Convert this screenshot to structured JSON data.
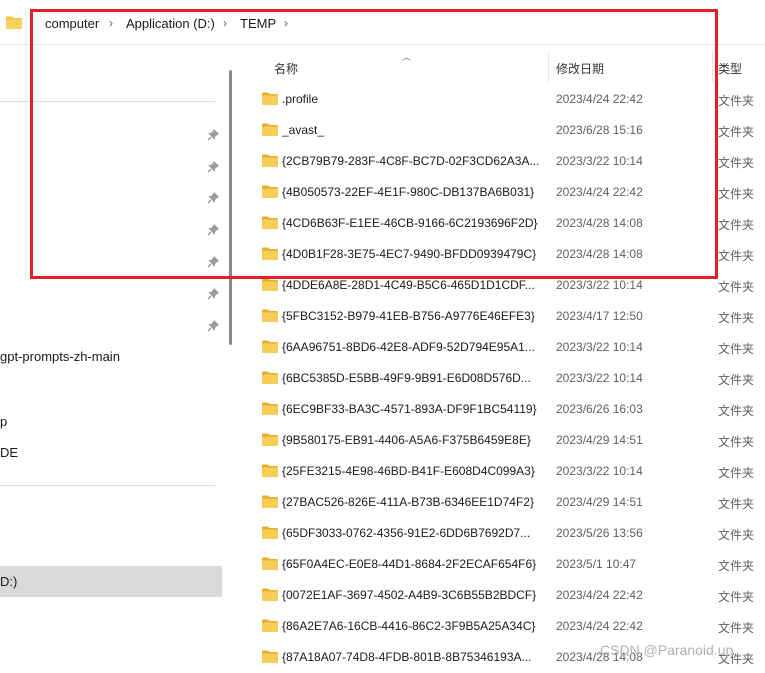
{
  "breadcrumb": [
    "computer",
    "Application (D:)",
    "TEMP"
  ],
  "nav": {
    "items": [
      "gpt-prompts-zh-main",
      "p",
      "DE",
      "D:)"
    ]
  },
  "columns": {
    "name": "名称",
    "date": "修改日期",
    "type": "类型"
  },
  "files": [
    {
      "name": ".profile",
      "date": "2023/4/24 22:42",
      "type": "文件夹"
    },
    {
      "name": "_avast_",
      "date": "2023/6/28 15:16",
      "type": "文件夹"
    },
    {
      "name": "{2CB79B79-283F-4C8F-BC7D-02F3CD62A3A...",
      "date": "2023/3/22 10:14",
      "type": "文件夹"
    },
    {
      "name": "{4B050573-22EF-4E1F-980C-DB137BA6B031}",
      "date": "2023/4/24 22:42",
      "type": "文件夹"
    },
    {
      "name": "{4CD6B63F-E1EE-46CB-9166-6C2193696F2D}",
      "date": "2023/4/28 14:08",
      "type": "文件夹"
    },
    {
      "name": "{4D0B1F28-3E75-4EC7-9490-BFDD0939479C}",
      "date": "2023/4/28 14:08",
      "type": "文件夹"
    },
    {
      "name": "{4DDE6A8E-28D1-4C49-B5C6-465D1D1CDF...",
      "date": "2023/3/22 10:14",
      "type": "文件夹"
    },
    {
      "name": "{5FBC3152-B979-41EB-B756-A9776E46EFE3}",
      "date": "2023/4/17 12:50",
      "type": "文件夹"
    },
    {
      "name": "{6AA96751-8BD6-42E8-ADF9-52D794E95A1...",
      "date": "2023/3/22 10:14",
      "type": "文件夹"
    },
    {
      "name": "{6BC5385D-E5BB-49F9-9B91-E6D08D576D...",
      "date": "2023/3/22 10:14",
      "type": "文件夹"
    },
    {
      "name": "{6EC9BF33-BA3C-4571-893A-DF9F1BC54119}",
      "date": "2023/6/26 16:03",
      "type": "文件夹"
    },
    {
      "name": "{9B580175-EB91-4406-A5A6-F375B6459E8E}",
      "date": "2023/4/29 14:51",
      "type": "文件夹"
    },
    {
      "name": "{25FE3215-4E98-46BD-B41F-E608D4C099A3}",
      "date": "2023/3/22 10:14",
      "type": "文件夹"
    },
    {
      "name": "{27BAC526-826E-411A-B73B-6346EE1D74F2}",
      "date": "2023/4/29 14:51",
      "type": "文件夹"
    },
    {
      "name": "{65DF3033-0762-4356-91E2-6DD6B7692D7...",
      "date": "2023/5/26 13:56",
      "type": "文件夹"
    },
    {
      "name": "{65F0A4EC-E0E8-44D1-8684-2F2ECAF654F6}",
      "date": "2023/5/1 10:47",
      "type": "文件夹"
    },
    {
      "name": "{0072E1AF-3697-4502-A4B9-3C6B55B2BDCF}",
      "date": "2023/4/24 22:42",
      "type": "文件夹"
    },
    {
      "name": "{86A2E7A6-16CB-4416-86C2-3F9B5A25A34C}",
      "date": "2023/4/24 22:42",
      "type": "文件夹"
    },
    {
      "name": "{87A18A07-74D8-4FDB-801B-8B75346193A...",
      "date": "2023/4/28 14:08",
      "type": "文件夹"
    }
  ],
  "watermark": "CSDN @Paranoid.up",
  "colors": {
    "highlight": "#e3202a",
    "folder": "#f5c342",
    "selected": "#d9d9d9"
  },
  "icons": {
    "folder": "folder-icon",
    "pin": "pin-icon",
    "chevron": "chevron-right-icon"
  }
}
